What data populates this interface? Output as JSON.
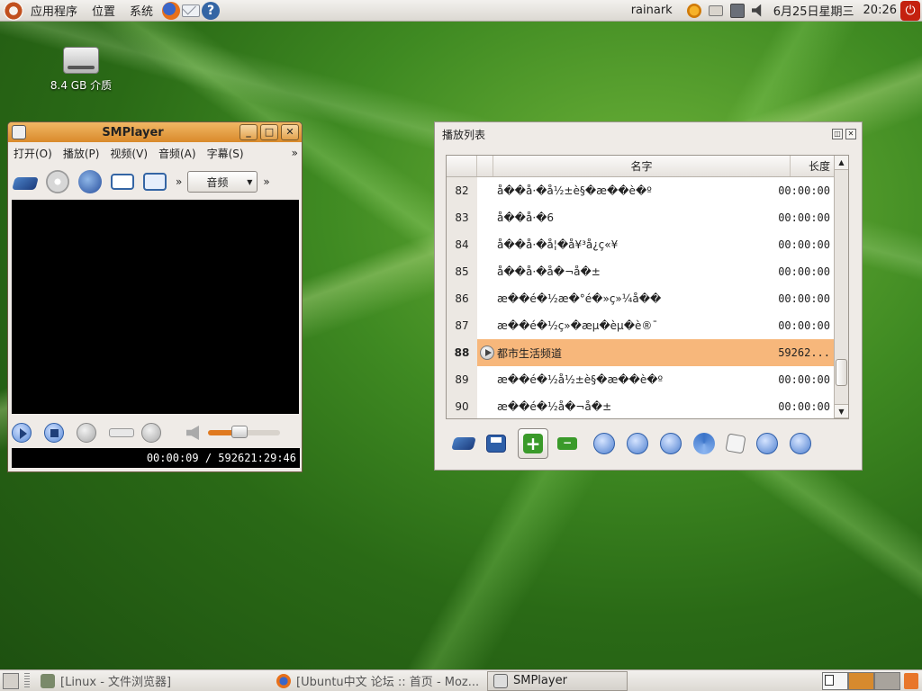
{
  "top_panel": {
    "menus": [
      "应用程序",
      "位置",
      "系统"
    ],
    "user": "rainark",
    "date": "6月25日星期三",
    "time": "20:26"
  },
  "desktop": {
    "drive_label": "8.4 GB 介质"
  },
  "smplayer": {
    "title": "SMPlayer",
    "menus": [
      "打开(O)",
      "播放(P)",
      "视频(V)",
      "音频(A)",
      "字幕(S)"
    ],
    "audio_combo": "音频",
    "status": "00:00:09 / 592621:29:46",
    "volume_percent": 45
  },
  "playlist": {
    "title": "播放列表",
    "col_name": "名字",
    "col_length": "长度",
    "rows": [
      {
        "n": "82",
        "name": "å��å·�å½±è§�æ��è�º",
        "dur": "00:00:00"
      },
      {
        "n": "83",
        "name": "å��å·�6",
        "dur": "00:00:00"
      },
      {
        "n": "84",
        "name": "å��å·�å¦�å¥³å¿ç«¥",
        "dur": "00:00:00"
      },
      {
        "n": "85",
        "name": "å��å·�å�¬å�±",
        "dur": "00:00:00"
      },
      {
        "n": "86",
        "name": "æ��é�½æ�°é�»ç»¼å��",
        "dur": "00:00:00"
      },
      {
        "n": "87",
        "name": "æ��é�½ç»�æµ�èµ�è®¯",
        "dur": "00:00:00"
      },
      {
        "n": "88",
        "name": "都市生活频道",
        "dur": "59262..."
      },
      {
        "n": "89",
        "name": "æ��é�½å½±è§�æ��è�º",
        "dur": "00:00:00"
      },
      {
        "n": "90",
        "name": "æ��é�½å�¬å�±",
        "dur": "00:00:00"
      }
    ]
  },
  "taskbar": {
    "tasks": [
      "[Linux - 文件浏览器]",
      "[Ubuntu中文 论坛 :: 首页 - Moz...",
      "SMPlayer"
    ]
  },
  "colors": {
    "title_accent": "#d98a2b",
    "active_row": "#f7b77b"
  }
}
